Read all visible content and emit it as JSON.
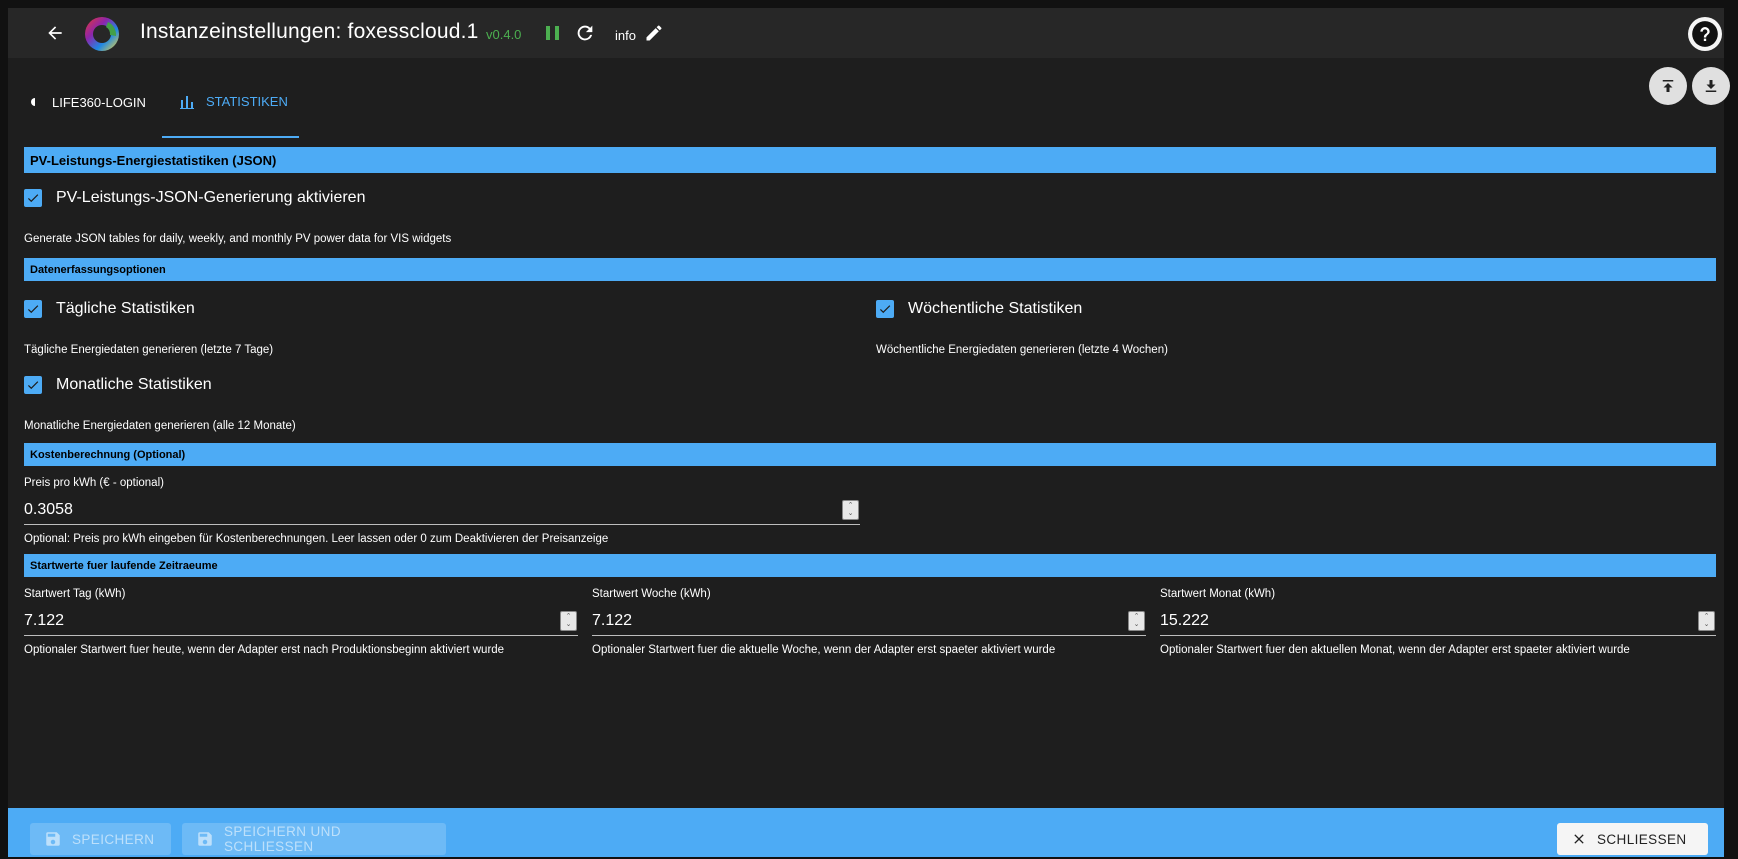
{
  "header": {
    "title": "Instanzeinstellungen:  foxesscloud.1",
    "version": "v0.4.0",
    "info_label": "info"
  },
  "tabs": [
    {
      "label": "LIFE360-LOGIN",
      "active": false
    },
    {
      "label": "STATISTIKEN",
      "active": true
    }
  ],
  "sections": {
    "pv_json": {
      "title": "PV-Leistungs-Energiestatistiken (JSON)",
      "enable_label": "PV-Leistungs-JSON-Generierung aktivieren",
      "enable_checked": true,
      "enable_help": "Generate JSON tables for daily, weekly, and monthly PV power data for VIS widgets"
    },
    "collection": {
      "title": "Datenerfassungsoptionen",
      "daily_label": "Tägliche Statistiken",
      "daily_checked": true,
      "daily_help": "Tägliche Energiedaten generieren (letzte 7 Tage)",
      "weekly_label": "Wöchentliche Statistiken",
      "weekly_checked": true,
      "weekly_help": "Wöchentliche Energiedaten generieren (letzte 4 Wochen)",
      "monthly_label": "Monatliche Statistiken",
      "monthly_checked": true,
      "monthly_help": "Monatliche Energiedaten generieren (alle 12 Monate)"
    },
    "cost": {
      "title": "Kostenberechnung (Optional)",
      "price_label": "Preis pro kWh (€ - optional)",
      "price_value": "0.3058",
      "price_help": "Optional: Preis pro kWh eingeben für Kostenberechnungen. Leer lassen oder 0 zum Deaktivieren der Preisanzeige"
    },
    "start_values": {
      "title": "Startwerte fuer laufende Zeitraeume",
      "day_label": "Startwert Tag (kWh)",
      "day_value": "7.122",
      "day_help": "Optionaler Startwert fuer heute, wenn der Adapter erst nach Produktionsbeginn aktiviert wurde",
      "week_label": "Startwert Woche (kWh)",
      "week_value": "7.122",
      "week_help": "Optionaler Startwert fuer die aktuelle Woche, wenn der Adapter erst spaeter aktiviert wurde",
      "month_label": "Startwert Monat (kWh)",
      "month_value": "15.222",
      "month_help": "Optionaler Startwert fuer den aktuellen Monat, wenn der Adapter erst spaeter aktiviert wurde"
    }
  },
  "footer": {
    "save_label": "SPEICHERN",
    "save_close_label": "SPEICHERN UND SCHLIESSEN",
    "close_label": "SCHLIESSEN"
  },
  "icons": {
    "back": "arrow-left-icon",
    "logo": "iobroker-logo",
    "pause": "pause-icon",
    "reload": "reload-icon",
    "edit": "pencil-icon",
    "help": "help-icon",
    "upload": "upload-icon",
    "download": "download-icon",
    "stats_tab": "chart-icon",
    "save": "floppy-disk-icon",
    "close": "close-icon"
  },
  "colors": {
    "accent": "#4dabf5",
    "version": "#4caf50",
    "background": "#1e1e1e",
    "header": "#272727"
  }
}
